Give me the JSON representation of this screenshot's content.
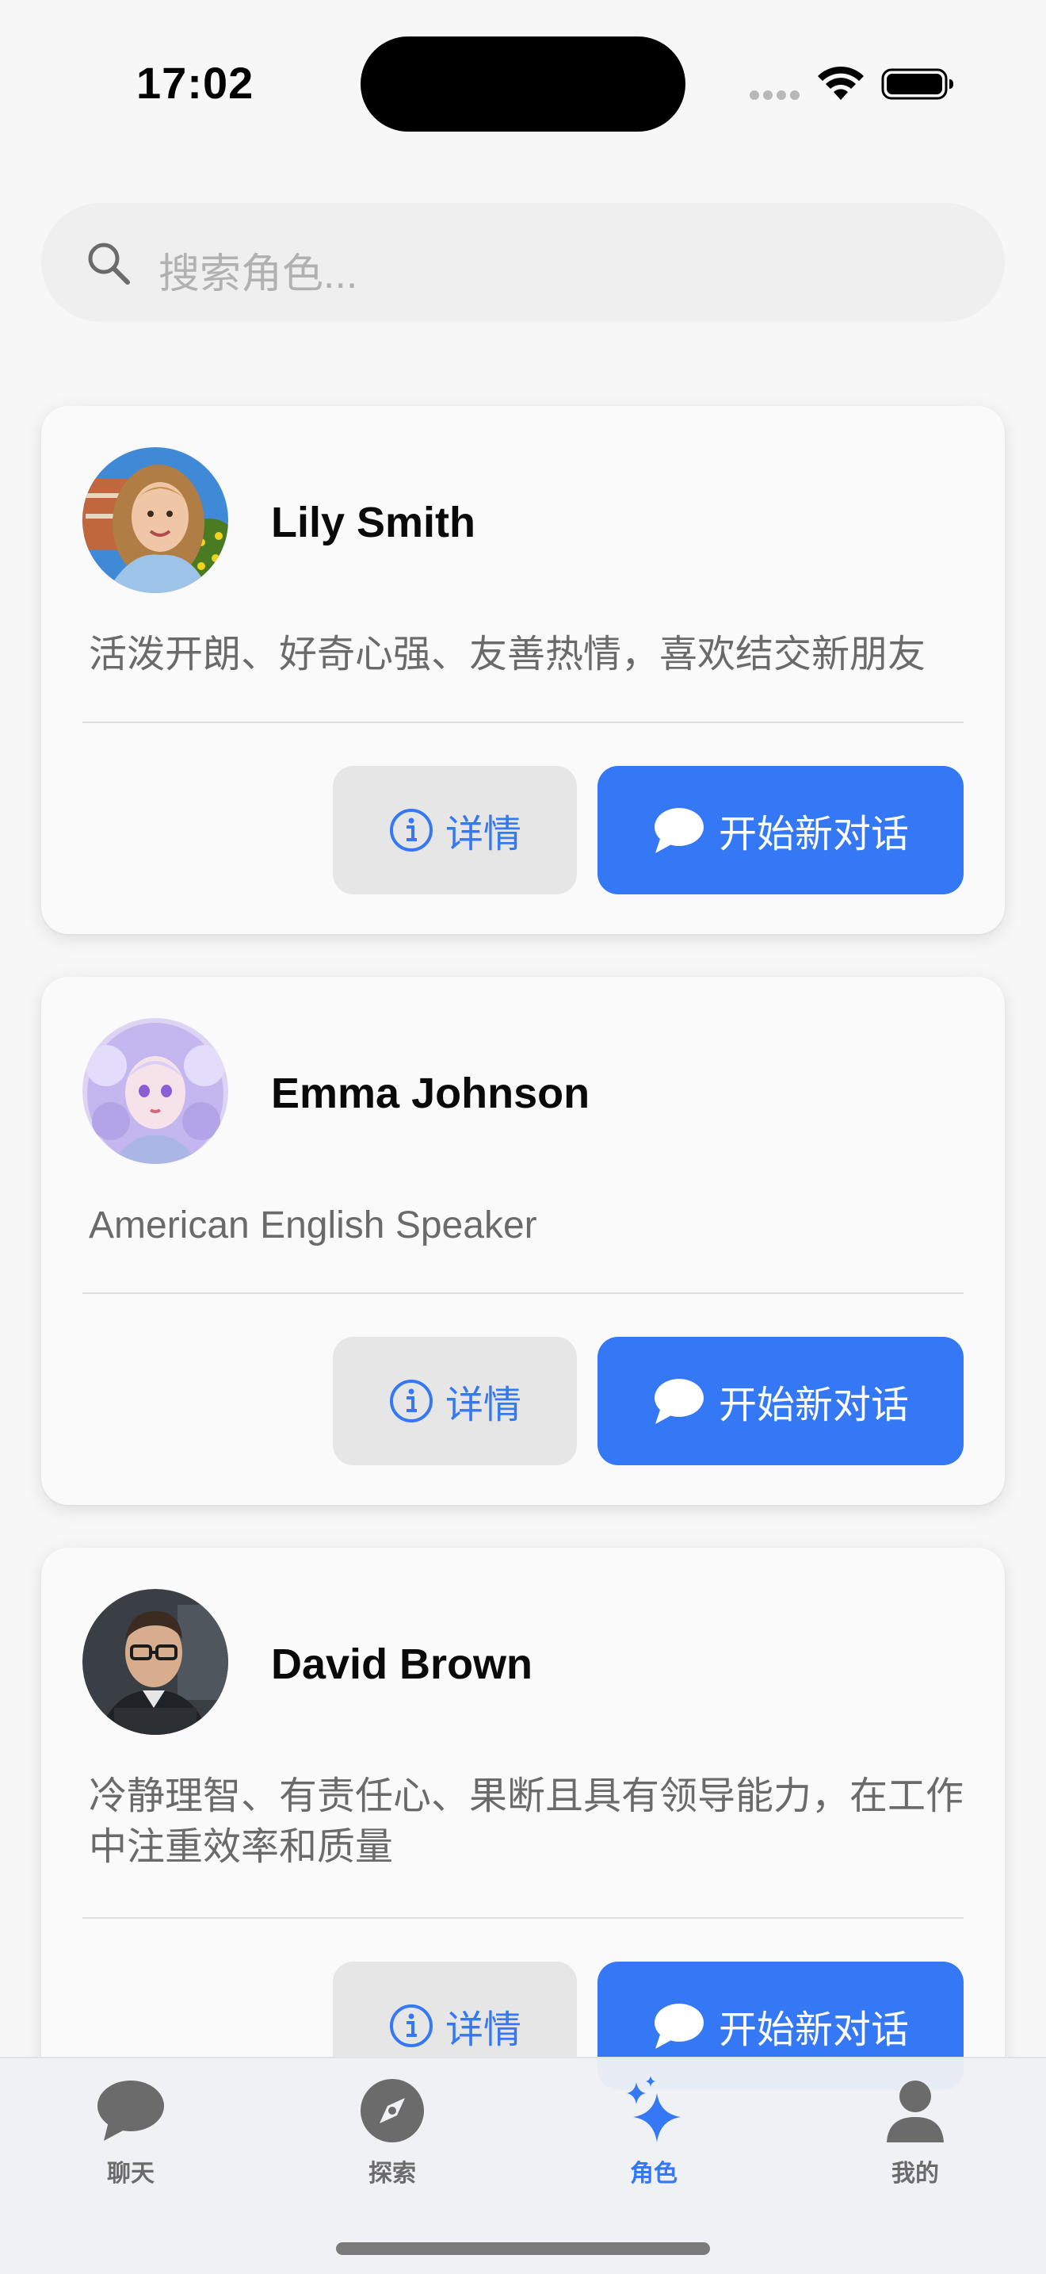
{
  "status_bar": {
    "time": "17:02"
  },
  "search": {
    "placeholder": "搜索角色..."
  },
  "characters": [
    {
      "name": "Lily Smith",
      "description": "活泼开朗、好奇心强、友善热情，喜欢结交新朋友",
      "detail_label": "详情",
      "chat_label": "开始新对话"
    },
    {
      "name": "Emma Johnson",
      "description": "American English Speaker",
      "detail_label": "详情",
      "chat_label": "开始新对话"
    },
    {
      "name": "David Brown",
      "description": "冷静理智、有责任心、果断且具有领导能力，在工作中注重效率和质量",
      "detail_label": "详情",
      "chat_label": "开始新对话"
    }
  ],
  "tab_bar": {
    "tabs": [
      {
        "label": "聊天",
        "icon": "chat-bubble-icon",
        "active": false
      },
      {
        "label": "探索",
        "icon": "compass-icon",
        "active": false
      },
      {
        "label": "角色",
        "icon": "sparkles-icon",
        "active": true
      },
      {
        "label": "我的",
        "icon": "person-icon",
        "active": false
      }
    ]
  },
  "colors": {
    "accent": "#3478f6",
    "background": "#f7f7f7",
    "card": "#fafafa",
    "secondary_button": "#e6e6e6",
    "secondary_text": "#6a6a6a",
    "inactive_tab": "#6b6b6b"
  }
}
